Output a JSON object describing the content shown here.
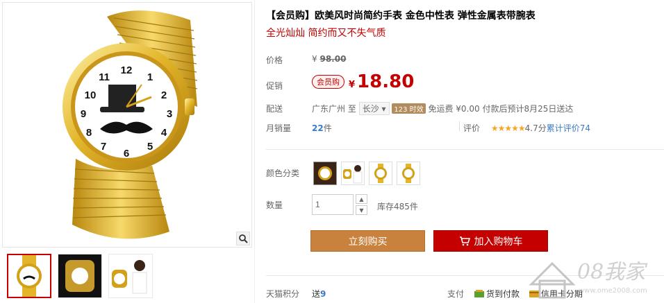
{
  "product": {
    "title": "【会员购】欧美风时尚简约手表 金色中性表 弹性金属表带腕表",
    "subtitle": "全光灿灿 简约而又不失气质"
  },
  "price": {
    "label": "价格",
    "currency": "¥",
    "original": "98.00"
  },
  "promo": {
    "label": "促销",
    "tag": "会员购",
    "currency": "¥",
    "value": "18.80"
  },
  "shipping": {
    "label": "配送",
    "from": "广东广州",
    "to_word": "至",
    "dest": "长沙",
    "time_badge": "123 时效",
    "fee": "免运费 ¥0.00",
    "estimate": "付款后预计8月25日送达"
  },
  "sales": {
    "label": "月销量",
    "count": "22",
    "unit": "件",
    "rating_label": "评价",
    "stars": "★★★★★",
    "score": "4.7分",
    "reviews_link": "累计评价74"
  },
  "sku": {
    "label": "颜色分类",
    "items": [
      "款式1",
      "款式2",
      "款式3",
      "款式4"
    ]
  },
  "quantity": {
    "label": "数量",
    "value": "1",
    "stock": "库存485件"
  },
  "actions": {
    "buy_now": "立刻购买",
    "add_cart": "加入购物车"
  },
  "footer": {
    "points_label": "天猫积分",
    "points_prefix": "送",
    "points_value": "9",
    "pay_label": "支付",
    "cod": "货到付款",
    "credit": "信用卡分期"
  },
  "watermark": {
    "text": "08我家",
    "url": "www.ome2008.com"
  },
  "colors": {
    "accent": "#c40000",
    "gold": "#d4a017",
    "buy_button": "#c9823d",
    "link": "#3b7ac4"
  }
}
